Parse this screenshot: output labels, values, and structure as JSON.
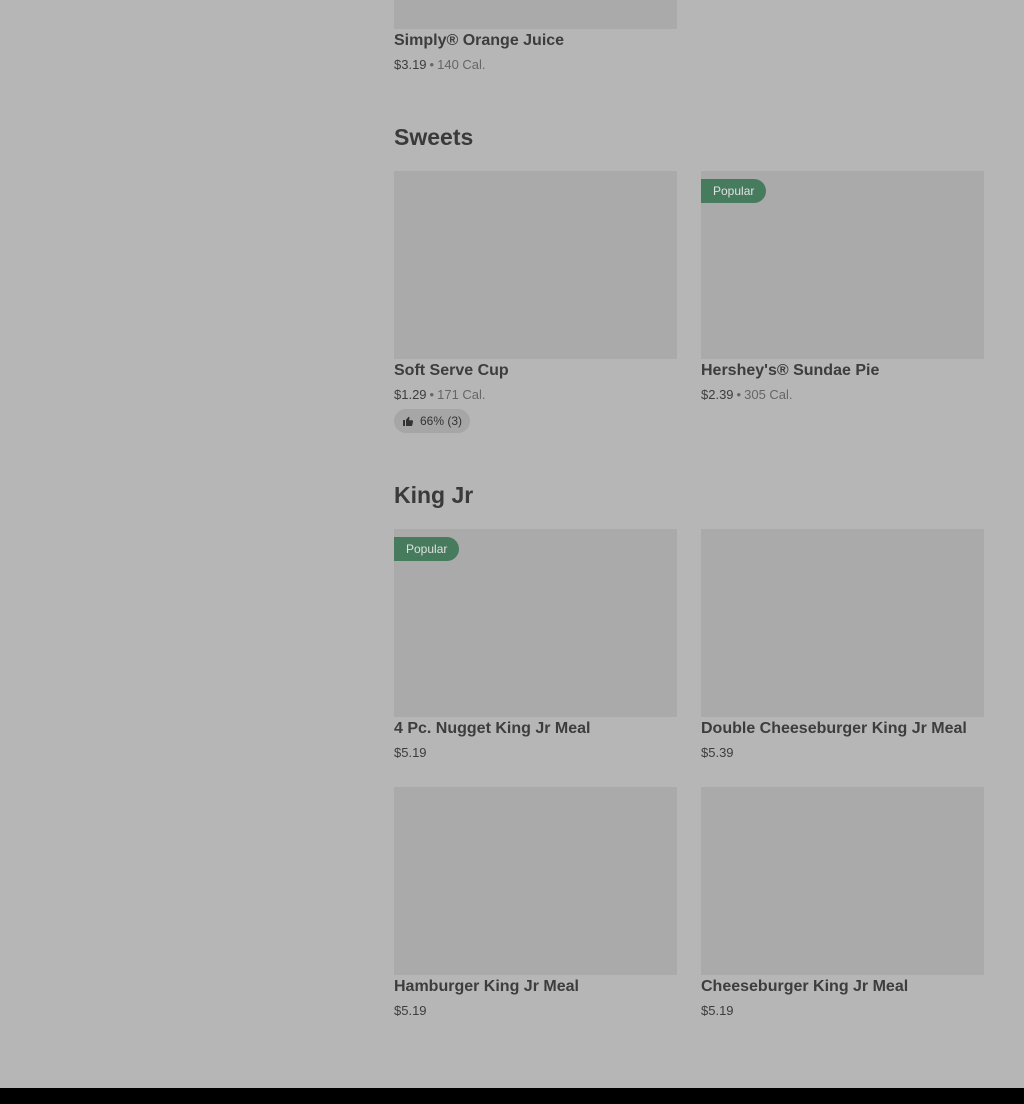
{
  "sections": {
    "top_item": {
      "name": "Simply® Orange Juice",
      "price": "$3.19",
      "calories": "140 Cal."
    },
    "sweets": {
      "title": "Sweets",
      "items": [
        {
          "name": "Soft Serve Cup",
          "price": "$1.29",
          "calories": "171 Cal.",
          "rating": "66% (3)"
        },
        {
          "name": "Hershey's® Sundae Pie",
          "price": "$2.39",
          "calories": "305 Cal.",
          "badge": "Popular"
        }
      ]
    },
    "king_jr": {
      "title": "King Jr",
      "items": [
        {
          "name": "4 Pc. Nugget King Jr Meal",
          "price": "$5.19",
          "badge": "Popular"
        },
        {
          "name": "Double Cheeseburger King Jr Meal",
          "price": "$5.39"
        },
        {
          "name": "Hamburger King Jr Meal",
          "price": "$5.19"
        },
        {
          "name": "Cheeseburger King Jr Meal",
          "price": "$5.19"
        }
      ]
    }
  },
  "meta_separator": "•",
  "colors": {
    "overlay_background": "#b6b6b6",
    "image_placeholder": "#aaaaaa",
    "popular_badge": "#477b5e",
    "footer": "#000000"
  },
  "icons": {
    "rating": "thumbs-up-icon"
  }
}
